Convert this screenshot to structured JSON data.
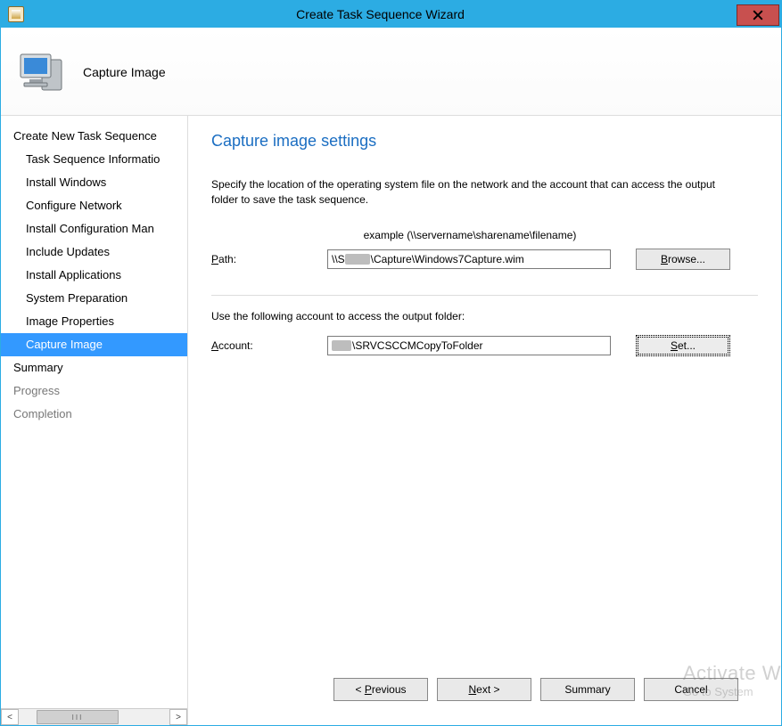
{
  "window": {
    "title": "Create Task Sequence Wizard"
  },
  "header": {
    "title": "Capture Image"
  },
  "nav": {
    "section_create": "Create New Task Sequence",
    "items": [
      "Task Sequence Informatio",
      "Install Windows",
      "Configure Network",
      "Install Configuration Man",
      "Include Updates",
      "Install Applications",
      "System Preparation",
      "Image Properties",
      "Capture Image"
    ],
    "summary": "Summary",
    "progress": "Progress",
    "completion": "Completion"
  },
  "main": {
    "heading": "Capture image settings",
    "description": "Specify the location of the operating system file on the network and the account that can access the output folder to save the task sequence.",
    "example": "example (\\\\servername\\sharename\\filename)",
    "path_label_ul": "P",
    "path_label_rest": "ath:",
    "path_prefix": "\\\\S",
    "path_suffix": "\\Capture\\Windows7Capture.wim",
    "browse_ul": "B",
    "browse_rest": "rowse...",
    "account_intro": "Use the following account to access the output folder:",
    "account_label_ul": "A",
    "account_label_rest": "ccount:",
    "account_value": "\\SRVCSCCMCopyToFolder",
    "set_label_ul": "S",
    "set_label_rest": "et..."
  },
  "watermark": {
    "big": "Activate W",
    "small": "Go to System"
  },
  "footer": {
    "prev_pre": "< ",
    "prev_ul": "P",
    "prev_rest": "revious",
    "next_ul": "N",
    "next_rest": "ext >",
    "summary": "Summary",
    "cancel": "Cancel"
  }
}
